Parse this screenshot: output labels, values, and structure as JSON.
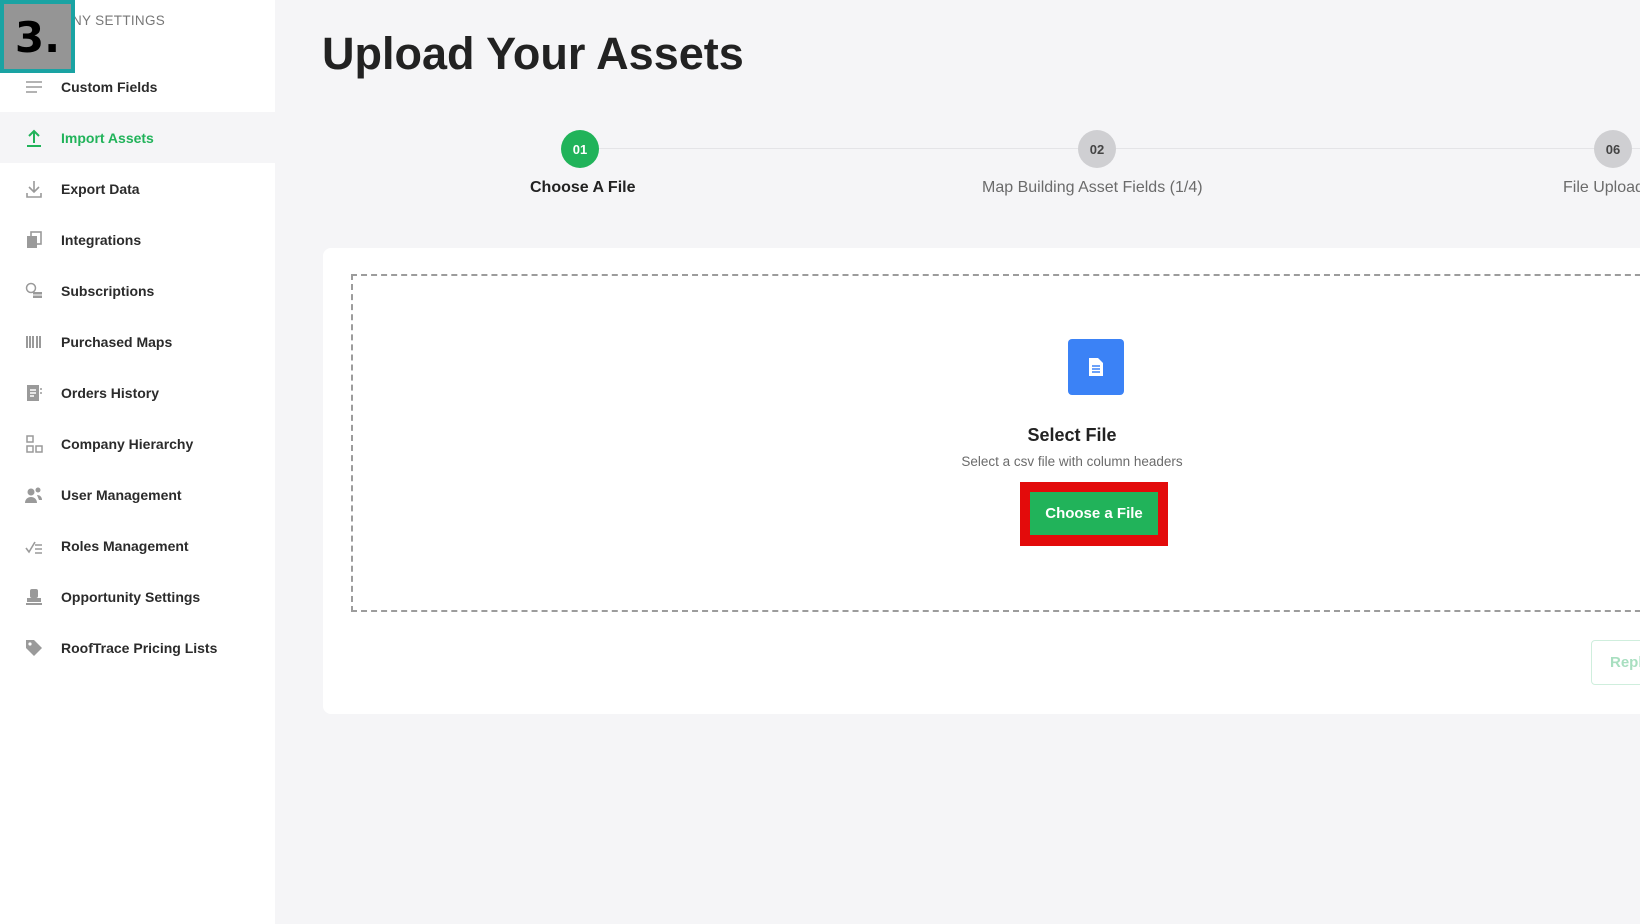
{
  "tutorial_step": "3.",
  "sidebar": {
    "header": "NY SETTINGS",
    "items": [
      {
        "label": "Custom Fields",
        "icon": "lines-icon"
      },
      {
        "label": "Import Assets",
        "icon": "upload-icon",
        "active": true
      },
      {
        "label": "Export Data",
        "icon": "download-icon"
      },
      {
        "label": "Integrations",
        "icon": "integrations-icon"
      },
      {
        "label": "Subscriptions",
        "icon": "coins-icon"
      },
      {
        "label": "Purchased Maps",
        "icon": "barcode-icon"
      },
      {
        "label": "Orders History",
        "icon": "receipt-icon"
      },
      {
        "label": "Company Hierarchy",
        "icon": "hierarchy-icon"
      },
      {
        "label": "User Management",
        "icon": "users-icon"
      },
      {
        "label": "Roles Management",
        "icon": "checklist-icon"
      },
      {
        "label": "Opportunity Settings",
        "icon": "stamp-icon"
      },
      {
        "label": "RoofTrace Pricing Lists",
        "icon": "tag-icon"
      }
    ]
  },
  "main": {
    "title": "Upload Your Assets",
    "steps": [
      {
        "number": "01",
        "label": "Choose A File",
        "state": "current"
      },
      {
        "number": "02",
        "label": "Map Building Asset Fields (1/4)",
        "state": "todo"
      },
      {
        "number": "06",
        "label": "File Upload",
        "state": "todo"
      }
    ],
    "upload": {
      "icon": "document-icon",
      "title": "Select File",
      "subtitle": "Select a csv file with column headers",
      "button_label": "Choose a File",
      "replace_label": "Replace"
    }
  },
  "colors": {
    "accent_green": "#21b35a",
    "file_icon_blue": "#3b82f6",
    "highlight_red": "#e30b0b",
    "badge_border_teal": "#1aa3a3"
  }
}
